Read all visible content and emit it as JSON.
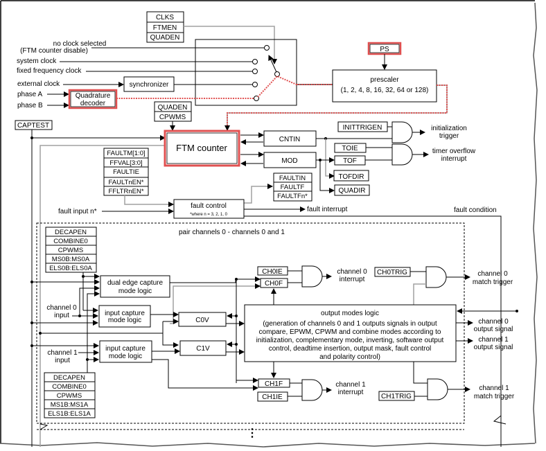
{
  "diagram": {
    "colors": {
      "highlight": "#e05050",
      "line": "#000000",
      "gray_line": "#a0a0a0",
      "background": "#ffffff"
    },
    "clock_select_regs": [
      "CLKS",
      "FTMEN",
      "QUADEN"
    ],
    "clock_sources": {
      "no_clock_line1": "no clock selected",
      "no_clock_line2": "(FTM counter disable)",
      "system": "system clock",
      "fixed": "fixed frequency clock",
      "external": "external clock",
      "phase_a": "phase A",
      "phase_b": "phase B"
    },
    "synchronizer": "synchronizer",
    "quadrature_decoder": {
      "line1": "Quadrature",
      "line2": "decoder"
    },
    "ps_reg": "PS",
    "prescaler": {
      "line1": "prescaler",
      "line2": "(1, 2, 4, 8, 16, 32, 64 or 128)"
    },
    "counter_mode_regs": [
      "QUADEN",
      "CPWMS"
    ],
    "captest": "CAPTEST",
    "ftm_counter": "FTM counter",
    "cntin": "CNTIN",
    "mod": "MOD",
    "inittrigen": "INITTRIGEN",
    "init_trigger": {
      "line1": "initialization",
      "line2": "trigger"
    },
    "toie": "TOIE",
    "tof": "TOF",
    "timer_overflow": {
      "line1": "timer overflow",
      "line2": "interrupt"
    },
    "tofdir": "TOFDIR",
    "quadir": "QUADIR",
    "fault_regs": [
      "FAULTM[1:0]",
      "FFVAL[3:0]",
      "FAULTIE",
      "FAULTnEN*",
      "FFLTRnEN*"
    ],
    "fault_status_regs": [
      "FAULTIN",
      "FAULTF",
      "FAULTFn*"
    ],
    "fault_input": "fault input n*",
    "fault_control": {
      "line1": "fault control",
      "line2": "*where n = 3, 2, 1, 0"
    },
    "fault_interrupt": "fault interrupt",
    "fault_condition": "fault condition",
    "pair_title": "pair channels 0 - channels 0 and 1",
    "ch0_regs": [
      "DECAPEN",
      "COMBINE0",
      "CPWMS",
      "MS0B:MS0A",
      "ELS0B:ELS0A"
    ],
    "ch1_regs": [
      "DECAPEN",
      "COMBINE0",
      "CPWMS",
      "MS1B:MS1A",
      "ELS1B:ELS1A"
    ],
    "dual_edge": {
      "line1": "dual edge capture",
      "line2": "mode logic"
    },
    "input_capture": {
      "line1": "input capture",
      "line2": "mode logic"
    },
    "ch0_input": {
      "line1": "channel 0",
      "line2": "input"
    },
    "ch1_input": {
      "line1": "channel 1",
      "line2": "input"
    },
    "c0v": "C0V",
    "c1v": "C1V",
    "ch0ie": "CH0IE",
    "ch0f": "CH0F",
    "ch1f": "CH1F",
    "ch1ie": "CH1IE",
    "ch0_interrupt": {
      "line1": "channel 0",
      "line2": "interrupt"
    },
    "ch1_interrupt": {
      "line1": "channel 1",
      "line2": "interrupt"
    },
    "ch0trig": "CH0TRIG",
    "ch1trig": "CH1TRIG",
    "ch0_match": {
      "line1": "channel 0",
      "line2": "match trigger"
    },
    "ch1_match": {
      "line1": "channel 1",
      "line2": "match trigger"
    },
    "output_logic": {
      "title": "output modes logic",
      "lines": [
        "(generation of channels 0 and 1 outputs signals in output",
        "compare, EPWM, CPWM and combine modes according to",
        "initialization, complementary mode, inverting, software output",
        "control, deadtime insertion, output mask, fault control",
        "and polarity control)"
      ]
    },
    "ch0_output": {
      "line1": "channel 0",
      "line2": "output signal"
    },
    "ch1_output": {
      "line1": "channel 1",
      "line2": "output signal"
    },
    "continuation": "⋮"
  }
}
